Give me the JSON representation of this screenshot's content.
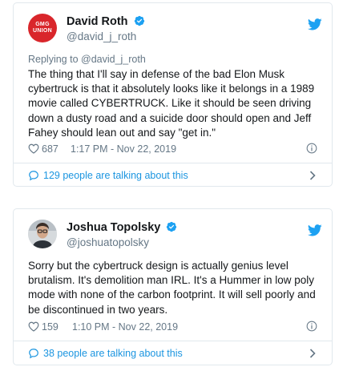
{
  "tweets": [
    {
      "avatar_text": [
        "GMG",
        "UNION"
      ],
      "name": "David Roth",
      "handle": "@david_j_roth",
      "reply_to": "Replying to @david_j_roth",
      "text": "The thing that I'll say in defense of the bad Elon Musk cybertruck is that it absolutely looks like it belongs in a 1989 movie called CYBERTRUCK. Like it should be seen driving down a dusty road and a suicide door should open and Jeff Fahey should lean out and say \"get in.\"",
      "likes": "687",
      "timestamp": "1:17 PM - Nov 22, 2019",
      "talking": "129 people are talking about this"
    },
    {
      "name": "Joshua Topolsky",
      "handle": "@joshuatopolsky",
      "text": "Sorry but the cybertruck design is actually genius level brutalism. It's demolition man IRL. It's a Hummer in low poly mode with none of the carbon footprint. It will sell poorly and be discontinued in two years.",
      "likes": "159",
      "timestamp": "1:10 PM - Nov 22, 2019",
      "talking": "38 people are talking about this"
    }
  ],
  "colors": {
    "twitter_blue": "#1da1f2",
    "link_blue": "#1b95e0",
    "secondary_text": "#657786",
    "border": "#e1e8ed",
    "gmg_red": "#d9262b"
  },
  "icons": [
    "twitter-bird-icon",
    "verified-badge-icon",
    "heart-icon",
    "info-icon",
    "speech-bubble-icon",
    "chevron-right-icon"
  ]
}
